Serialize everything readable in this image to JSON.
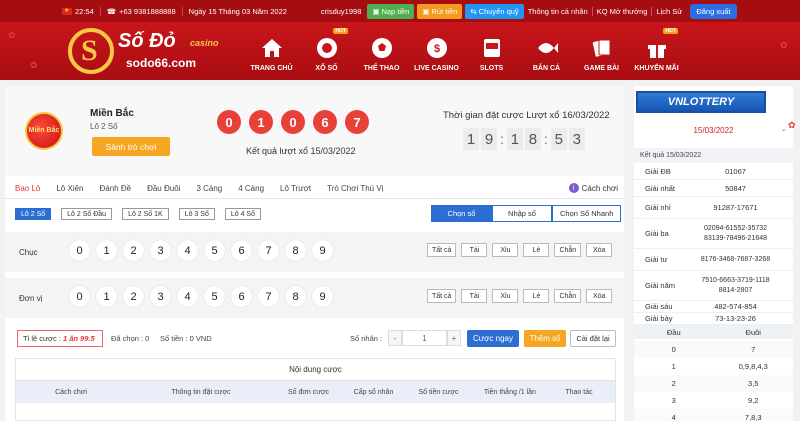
{
  "topbar": {
    "time": "22:54",
    "phone": "+63 9381888888",
    "date": "Ngày 15 Tháng 03 Năm 2022",
    "username": "crisduy1998",
    "deposit": "Nạp tiền",
    "withdraw": "Rút tiền",
    "transfer": "Chuyển quỹ",
    "personal_info": "Thông tin cá nhân",
    "kq_open": "KQ Mở thưởng",
    "history": "Lịch Sử",
    "logout": "Đăng xuất"
  },
  "logo": {
    "name": "Số Đỏ",
    "casino": "casino",
    "domain": "sodo66.com"
  },
  "nav": [
    {
      "label": "TRANG CHỦ",
      "icon": "home-icon"
    },
    {
      "label": "XỔ SỐ",
      "icon": "lottery-ball-icon",
      "hot": "HOT"
    },
    {
      "label": "THỂ THAO",
      "icon": "soccer-ball-icon"
    },
    {
      "label": "LIVE CASINO",
      "icon": "casino-chip-icon"
    },
    {
      "label": "SLOTS",
      "icon": "slot-machine-icon"
    },
    {
      "label": "BẮN CÁ",
      "icon": "fish-icon"
    },
    {
      "label": "GAME BÀI",
      "icon": "playing-cards-icon"
    },
    {
      "label": "KHUYẾN MÃI",
      "icon": "gift-icon",
      "hot": "HOT"
    }
  ],
  "region": {
    "badge": "Miền Bắc",
    "title": "Miền Bắc",
    "subtitle": "Lô 2 Số",
    "lobby_button": "Sảnh trò chơi",
    "result_balls": [
      "0",
      "1",
      "0",
      "6",
      "7"
    ],
    "result_label": "Kết quả lượt xổ 15/03/2022",
    "countdown_title": "Thời gian đặt cược Lượt xổ 16/03/2022",
    "countdown": [
      "1",
      "9",
      "1",
      "8",
      "5",
      "3"
    ]
  },
  "bet_types": [
    "Bao Lô",
    "Lô Xiên",
    "Đánh Đề",
    "Đầu Đuôi",
    "3 Càng",
    "4 Càng",
    "Lô Trượt",
    "Trò Chơi Thú Vị"
  ],
  "rules_link": "Cách chơi",
  "sub_types": [
    "Lô 2 Số",
    "Lô 2 Số Đầu",
    "Lô 2 Số 1K",
    "Lô 3 Số",
    "Lô 4 Số"
  ],
  "modes": [
    "Chọn số",
    "Nhập số",
    "Chọn Số Nhanh"
  ],
  "pick_rows": [
    {
      "label": "Chục",
      "numbers": [
        "0",
        "1",
        "2",
        "3",
        "4",
        "5",
        "6",
        "7",
        "8",
        "9"
      ]
    },
    {
      "label": "Đơn vị",
      "numbers": [
        "0",
        "1",
        "2",
        "3",
        "4",
        "5",
        "6",
        "7",
        "8",
        "9"
      ]
    }
  ],
  "quick_select": [
    "Tất cả",
    "Tài",
    "Xỉu",
    "Lẻ",
    "Chẵn",
    "Xóa"
  ],
  "bet_bar": {
    "ratio_label": "Tỉ lệ cược :",
    "ratio_value": "1 ăn 99.5",
    "selected": "Đã chọn : 0",
    "amount": "Số tiền : 0 VND",
    "multiplier_label": "Số nhân :",
    "multiplier_value": "1",
    "place_bet": "Cược ngay",
    "add_bet": "Thêm số",
    "reset": "Cài đặt lại"
  },
  "content": {
    "title": "Nội dung cược",
    "columns": [
      "Cách chơi",
      "Thông tin đặt cược",
      "Số đơn cược",
      "Cấp số nhân",
      "Số tiền cược",
      "Tiền thắng /1 lần",
      "Thao tác"
    ]
  },
  "sidebar": {
    "brand": "VNLOTTERY",
    "date": "15/03/2022",
    "kq_header": "Kết quả 15/03/2022",
    "prizes": [
      {
        "name": "Giải ĐB",
        "value": "01067"
      },
      {
        "name": "Giải nhất",
        "value": "50847"
      },
      {
        "name": "Giải nhì",
        "value": "91287-17671"
      },
      {
        "name": "Giải ba",
        "value": "02094-61552-35732\n83139-78496-21648"
      },
      {
        "name": "Giải tư",
        "value": "8176-3468-7687-3268"
      },
      {
        "name": "Giải năm",
        "value": "7510-6663-3719-1118\n8814-2807"
      },
      {
        "name": "Giải sáu",
        "value": "482-574-854"
      },
      {
        "name": "Giải bảy",
        "value": "73-13-23-26"
      }
    ],
    "loto_headers": [
      "Đầu",
      "Đuôi"
    ],
    "loto_rows": [
      {
        "head": "0",
        "tail": "7"
      },
      {
        "head": "1",
        "tail": "0,9,8,4,3"
      },
      {
        "head": "2",
        "tail": "3,5"
      },
      {
        "head": "3",
        "tail": "9,2"
      },
      {
        "head": "4",
        "tail": "7,8,3"
      }
    ]
  },
  "colors": {
    "brand_red": "#a50d10",
    "accent_blue": "#2d6ed3",
    "accent_orange": "#f5a623",
    "ball_red": "#e8413a"
  }
}
